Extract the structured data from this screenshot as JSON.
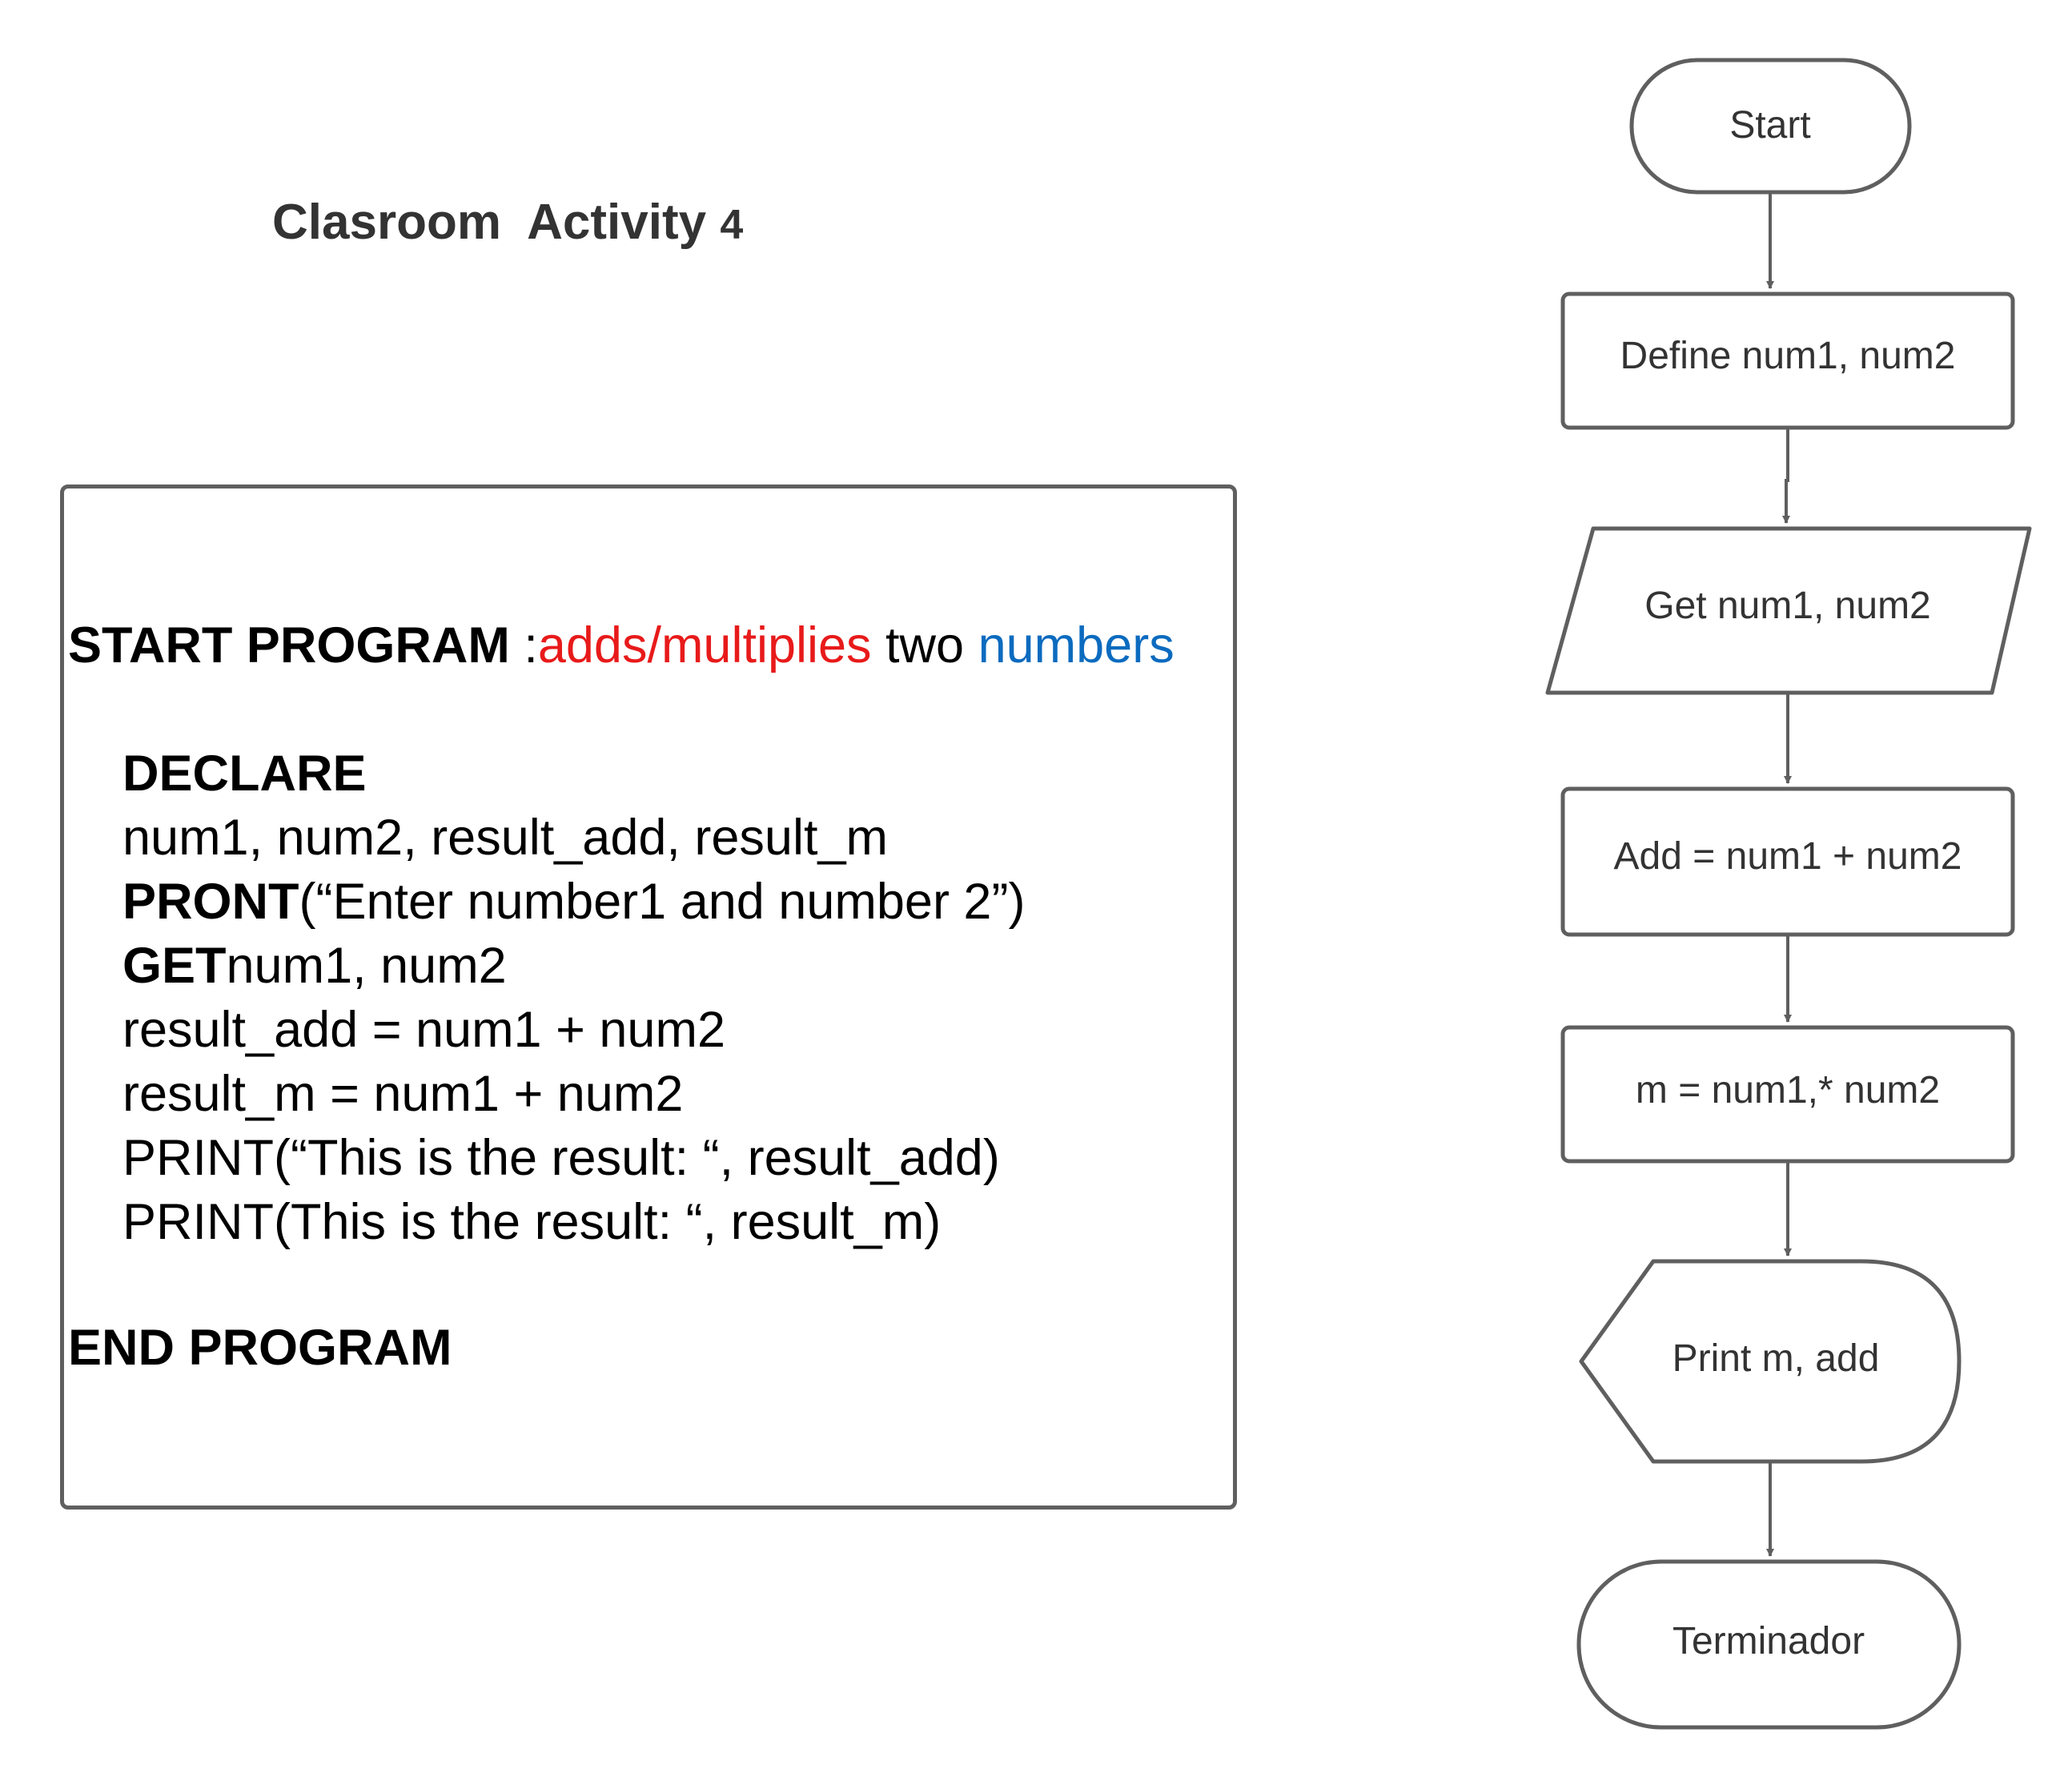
{
  "title": {
    "text": "Clasroom  Activity ",
    "number": "4"
  },
  "pseudocode": {
    "start_keyword": "START PROGRAM",
    "start_sep": " :",
    "start_desc_red": "adds/multiplies",
    "start_desc_black": " two ",
    "start_desc_blue": "numbers",
    "declare": "DECLARE",
    "vars": "num1, num2, result_add, result_m",
    "pront_kw": "PRONT",
    "pront_arg": "(“Enter number1 and number 2”)",
    "get_kw": "GET",
    "get_arg": "num1, num2",
    "add_line": "result_add = num1 + num2",
    "m_line": "result_m = num1 + num2",
    "print_add": "PRINT(“This is the result: “, result_add)",
    "print_m": "PRINT(This is the result: “, result_m)",
    "end_keyword": "END PROGRAM"
  },
  "flowchart": {
    "start": "Start",
    "define": "Define num1, num2",
    "get": "Get num1, num2",
    "add": "Add = num1 + num2",
    "mult": "m = num1,* num2",
    "print": "Print m, add",
    "end": "Terminador"
  },
  "colors": {
    "stroke": "#5f5f5f",
    "red": "#e81a1a",
    "blue": "#0b6bbf"
  }
}
